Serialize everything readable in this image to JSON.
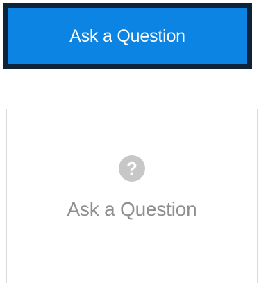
{
  "primary_button": {
    "label": "Ask a Question"
  },
  "secondary_card": {
    "icon": "question-circle-icon",
    "icon_glyph": "?",
    "label": "Ask a Question"
  },
  "colors": {
    "primary_bg": "#0b84e3",
    "primary_border": "#0f2338",
    "primary_text": "#ffffff",
    "secondary_border": "#d9d9d9",
    "secondary_icon": "#c7c7c7",
    "secondary_text": "#8f8f8f"
  }
}
